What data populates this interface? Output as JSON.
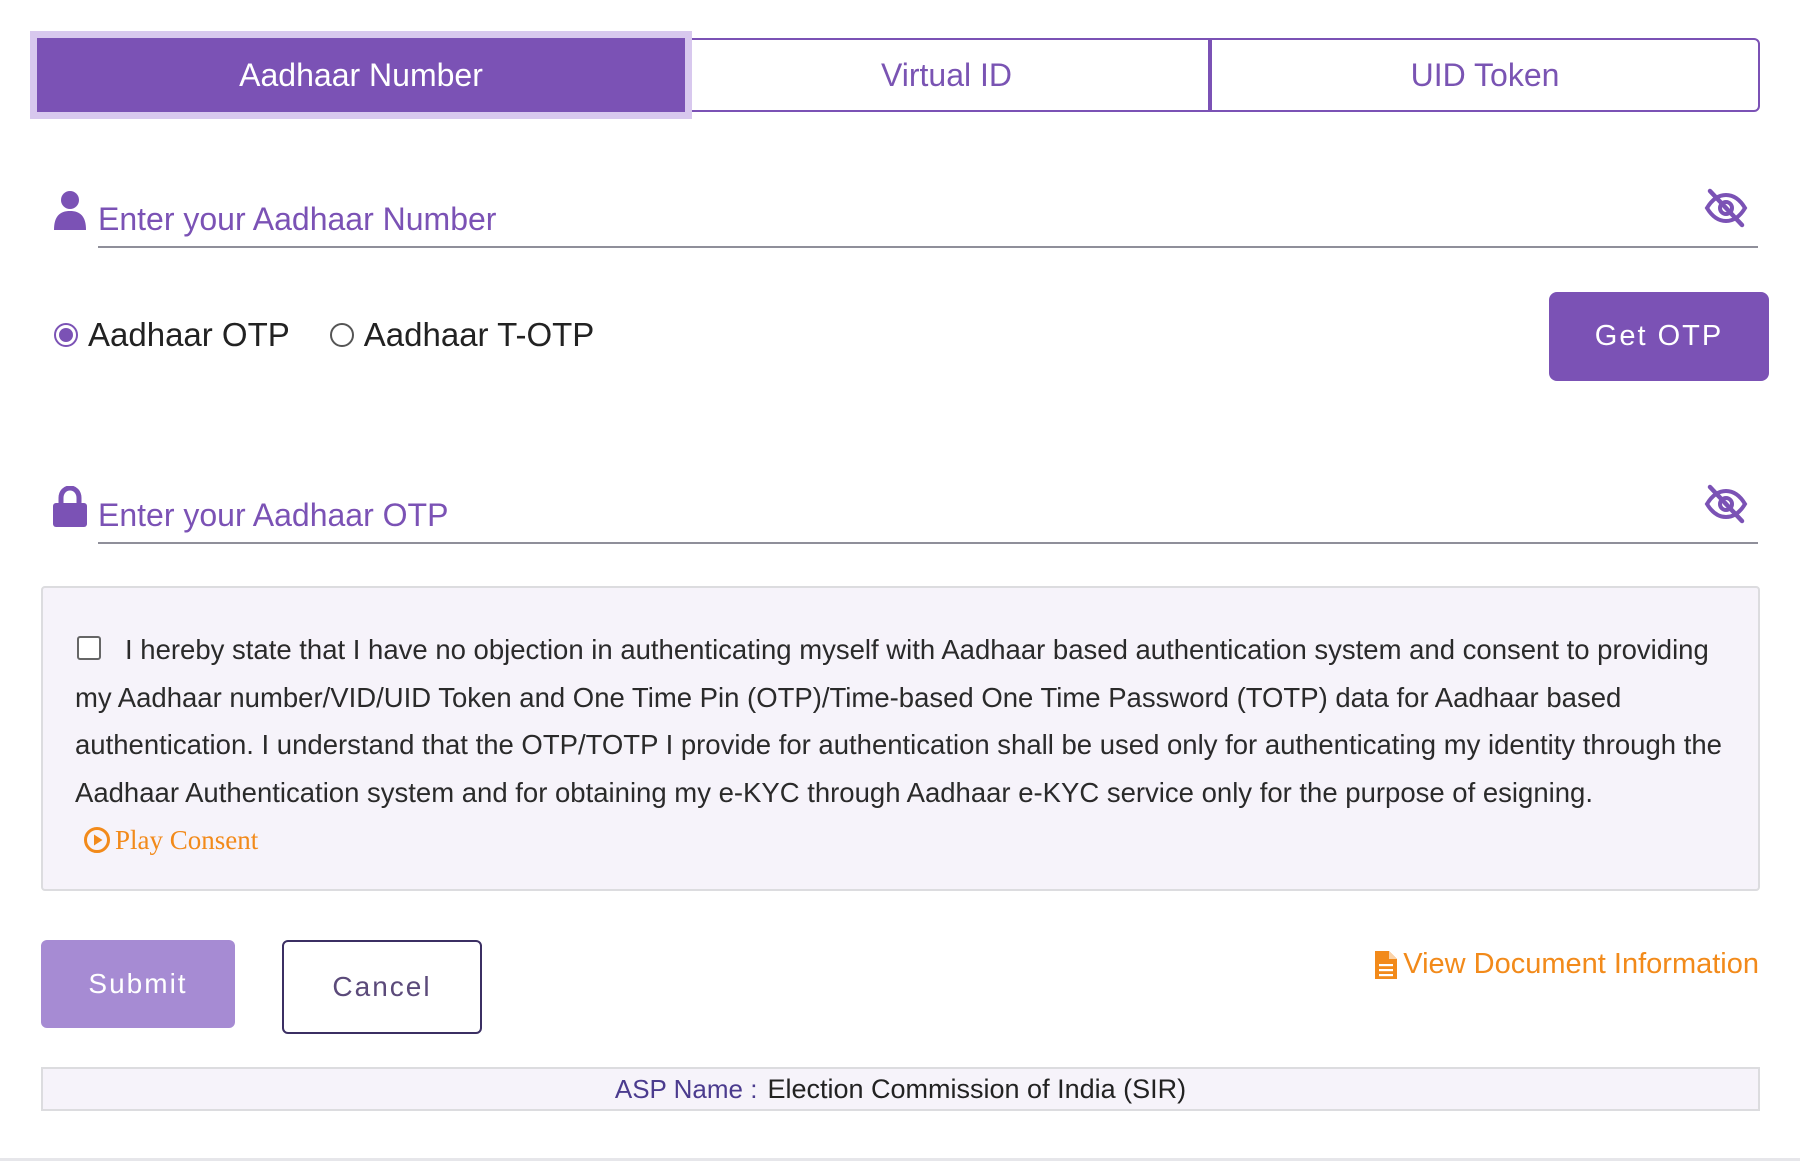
{
  "tabs": [
    {
      "label": "Aadhaar Number",
      "active": true
    },
    {
      "label": "Virtual ID",
      "active": false
    },
    {
      "label": "UID Token",
      "active": false
    }
  ],
  "aadhaar_input": {
    "placeholder": "Enter your Aadhaar Number",
    "value": "",
    "icon": "user-icon",
    "toggle_icon": "eye-slash-icon"
  },
  "otp_type": {
    "options": [
      {
        "label": "Aadhaar OTP",
        "selected": true
      },
      {
        "label": "Aadhaar T-OTP",
        "selected": false
      }
    ],
    "get_otp_label": "Get OTP"
  },
  "otp_input": {
    "placeholder": "Enter your Aadhaar OTP",
    "value": "",
    "icon": "lock-icon",
    "toggle_icon": "eye-slash-icon"
  },
  "consent": {
    "checked": false,
    "text": "I hereby state that I have no objection in authenticating myself with Aadhaar based authentication system and consent to providing my Aadhaar number/VID/UID Token and One Time Pin (OTP)/Time-based One Time Password (TOTP) data for Aadhaar based authentication. I understand that the OTP/TOTP I provide for authentication shall be used only for authenticating my identity through the Aadhaar Authentication system and for obtaining my e-KYC through Aadhaar e-KYC service only for the purpose of esigning.",
    "play_label": "Play Consent"
  },
  "actions": {
    "submit_label": "Submit",
    "cancel_label": "Cancel",
    "doc_info_label": "View Document Information"
  },
  "asp": {
    "label": "ASP Name :",
    "value": "Election Commission of India (SIR)"
  },
  "colors": {
    "primary": "#7b52b5",
    "primary_light": "#a68bd3",
    "accent": "#f28a1a",
    "panel_bg": "#f6f3fa"
  }
}
